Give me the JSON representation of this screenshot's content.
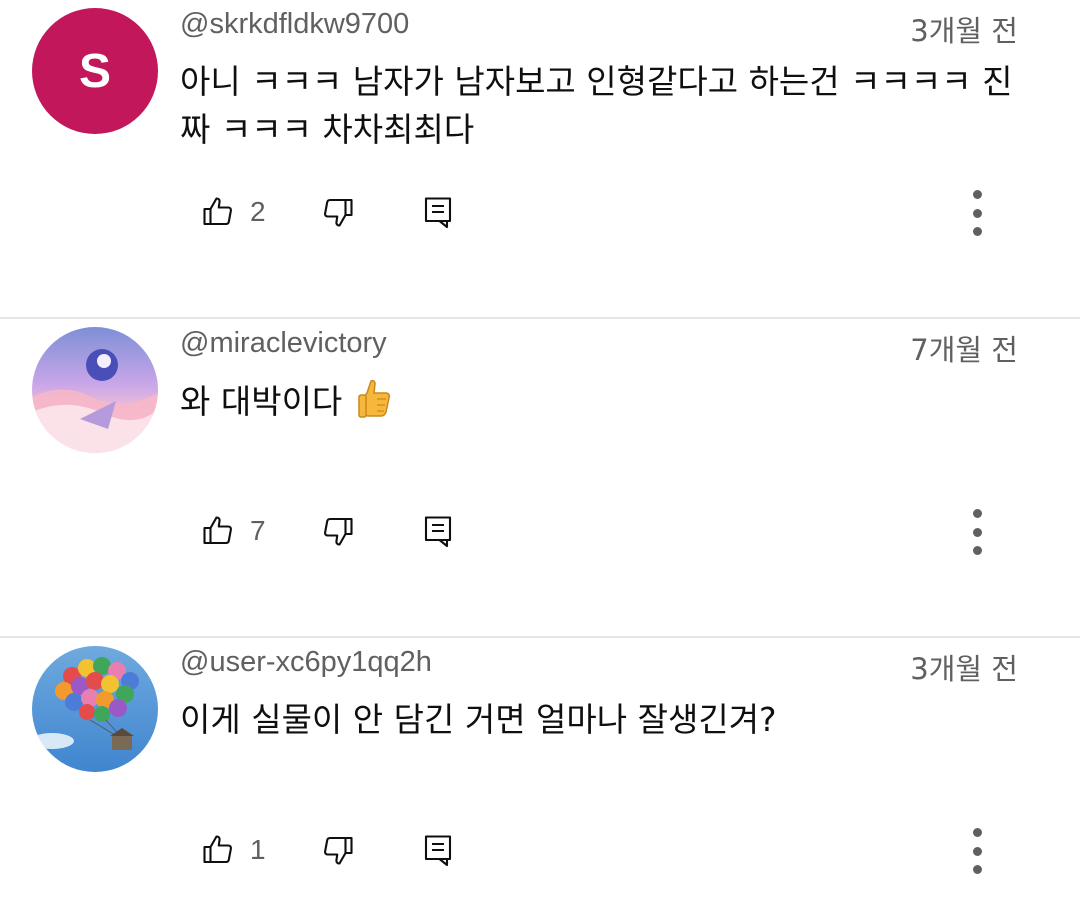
{
  "comments": [
    {
      "avatar_letter": "S",
      "avatar_color": "#c2185b",
      "handle": "@skrkdfldkw9700",
      "time": "3개월 전",
      "text": "아니 ㅋㅋㅋ 남자가 남자보고 인형같다고 하는건 ㅋㅋㅋㅋ 진짜 ㅋㅋㅋ 차차최최다",
      "likes": "2",
      "icons": {
        "like": "thumb-up-icon",
        "dislike": "thumb-down-icon",
        "reply": "comment-icon",
        "more": "more-vert-icon"
      }
    },
    {
      "avatar_type": "image",
      "handle": "@miraclevictory",
      "time": "7개월 전",
      "text": "와 대박이다",
      "emoji": "thumbs-up-emoji",
      "likes": "7",
      "icons": {
        "like": "thumb-up-icon",
        "dislike": "thumb-down-icon",
        "reply": "comment-icon",
        "more": "more-vert-icon"
      }
    },
    {
      "avatar_type": "image",
      "handle": "@user-xc6py1qq2h",
      "time": "3개월 전",
      "text": "이게 실물이 안 담긴 거면 얼마나 잘생긴겨?",
      "likes": "1",
      "icons": {
        "like": "thumb-up-icon",
        "dislike": "thumb-down-icon",
        "reply": "comment-icon",
        "more": "more-vert-icon"
      }
    }
  ]
}
